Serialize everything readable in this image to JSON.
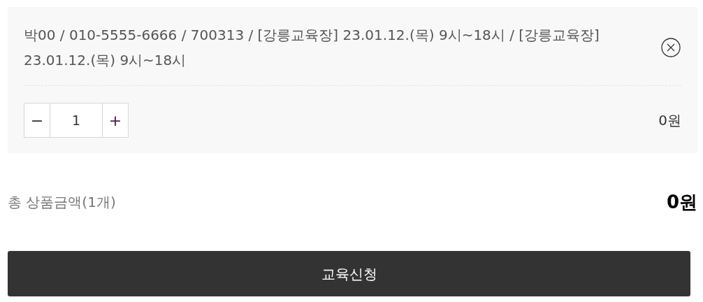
{
  "option": {
    "description": "박00 / 010-5555-6666 / 700313 / [강릉교육장] 23.01.12.(목) 9시~18시 / [강릉교육장] 23.01.12.(목) 9시~18시",
    "decrease": "−",
    "quantity": "1",
    "increase": "+",
    "price": "0원"
  },
  "total": {
    "label": "총 상품금액(1개)",
    "amount": "0원"
  },
  "submit_button": "교육신청"
}
